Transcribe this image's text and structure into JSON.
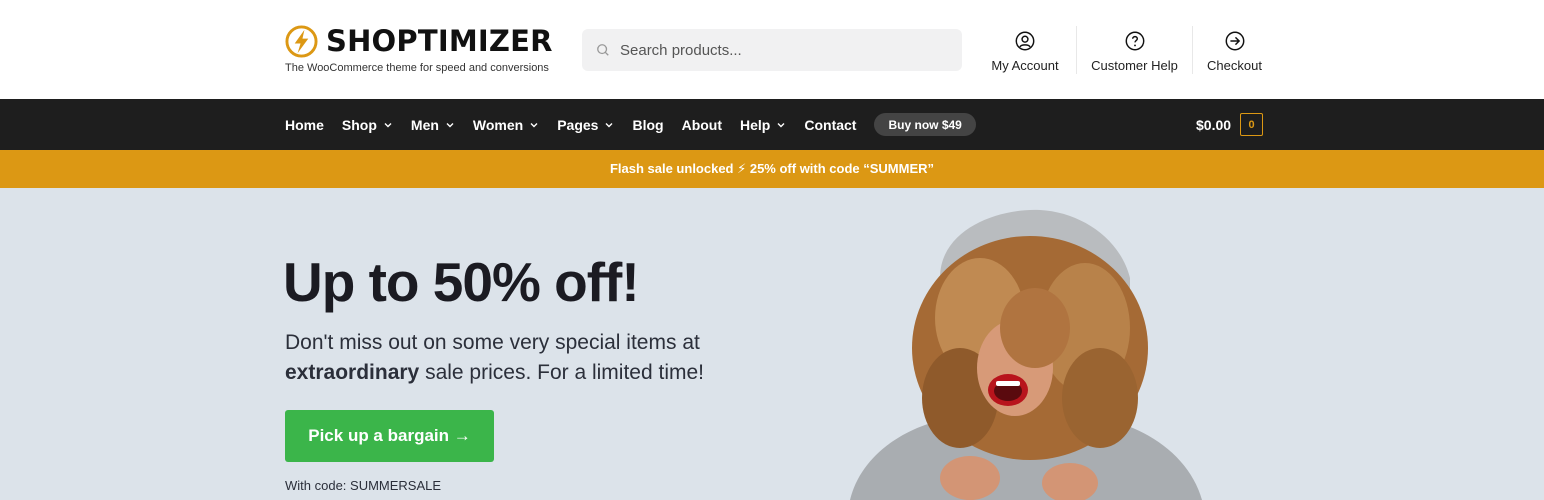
{
  "colors": {
    "accent": "#dc9814",
    "nav_bg": "#1e1e1e",
    "hero_bg": "#dce3ea",
    "cta": "#3bb54a"
  },
  "brand": {
    "name": "SHOPTIMIZER",
    "tagline": "The WooCommerce theme for speed and conversions",
    "logo_icon": "lightning-bolt-icon"
  },
  "search": {
    "placeholder": "Search products...",
    "value": ""
  },
  "header_links": [
    {
      "label": "My Account",
      "icon": "user-icon"
    },
    {
      "label": "Customer Help",
      "icon": "question-icon"
    },
    {
      "label": "Checkout",
      "icon": "arrow-right-circle-icon"
    }
  ],
  "nav": {
    "items": [
      {
        "label": "Home",
        "has_dropdown": false
      },
      {
        "label": "Shop",
        "has_dropdown": true
      },
      {
        "label": "Men",
        "has_dropdown": true
      },
      {
        "label": "Women",
        "has_dropdown": true
      },
      {
        "label": "Pages",
        "has_dropdown": true
      },
      {
        "label": "Blog",
        "has_dropdown": false
      },
      {
        "label": "About",
        "has_dropdown": false
      },
      {
        "label": "Help",
        "has_dropdown": true
      },
      {
        "label": "Contact",
        "has_dropdown": false
      }
    ],
    "buy_button": "Buy now $49",
    "cart_total": "$0.00",
    "cart_count": "0"
  },
  "promo": {
    "text": "Flash sale unlocked ⚡ 25% off with code “SUMMER”"
  },
  "hero": {
    "title": "Up to 50% off!",
    "subtitle_pre": "Don't miss out on some very special items at ",
    "subtitle_bold": "extraordinary",
    "subtitle_post": " sale prices. For a limited time!",
    "cta_label": "Pick up a bargain →",
    "code_note": "With code: SUMMERSALE"
  }
}
